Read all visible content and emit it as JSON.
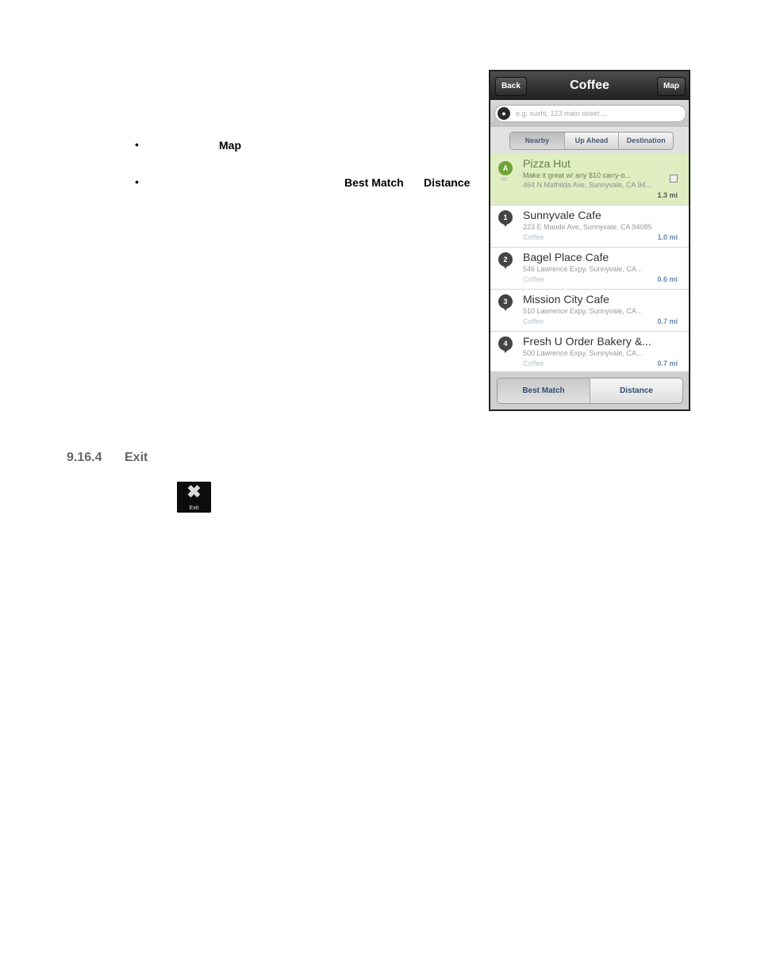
{
  "doc": {
    "bullet1_bold": "Map",
    "bullet2_bold1": "Best Match",
    "bullet2_bold2": "Distance",
    "section_number": "9.16.4",
    "section_title": "Exit",
    "exit_icon": "x-icon",
    "exit_label": "Exit"
  },
  "phone": {
    "nav": {
      "back": "Back",
      "title": "Coffee",
      "map": "Map"
    },
    "search": {
      "placeholder": "e.g. sushi, 123 main street ...",
      "icon": "mic-icon"
    },
    "tabs": [
      "Nearby",
      "Up Ahead",
      "Destination"
    ],
    "active_tab": "Nearby",
    "results": [
      {
        "marker": "A",
        "ad": "AD",
        "name": "Pizza Hut",
        "line1": "Make it great w/ any $10 carry-o...",
        "line2": "464 N Mathilda Ave, Sunnyvale, CA 94...",
        "distance": "1.3 mi"
      },
      {
        "marker": "1",
        "name": "Sunnyvale Cafe",
        "line1": "223 E Maude Ave, Sunnyvale, CA 94085",
        "line2": "Coffee",
        "distance": "1.0 mi"
      },
      {
        "marker": "2",
        "name": "Bagel Place Cafe",
        "line1": "546 Lawrence Expy, Sunnyvale, CA...",
        "line2": "Coffee",
        "distance": "0.6 mi"
      },
      {
        "marker": "3",
        "name": "Mission City Cafe",
        "line1": "510 Lawrence Expy, Sunnyvale, CA...",
        "line2": "Coffee",
        "distance": "0.7 mi"
      },
      {
        "marker": "4",
        "name": "Fresh U Order Bakery &...",
        "line1": "500 Lawrence Expy, Sunnyvale, CA...",
        "line2": "Coffee",
        "distance": "0.7 mi"
      }
    ],
    "sort": [
      "Best Match",
      "Distance"
    ],
    "active_sort": "Best Match",
    "colors": {
      "ad_row": "#dfedc1",
      "accent": "#6a89b0",
      "ad_marker": "#6ea43a"
    }
  }
}
